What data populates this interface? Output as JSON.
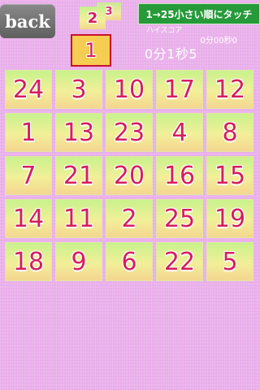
{
  "header": {
    "back_label": "back",
    "instruction": "1→25小さい順にタッチ",
    "highscore_label": "ハイスコア",
    "highscore_value": "0分00秒0",
    "timer": "0分1秒5"
  },
  "next_numbers": {
    "first": "2",
    "second": "3"
  },
  "current_number": "1",
  "grid": {
    "rows": [
      [
        "24",
        "3",
        "10",
        "17",
        "12"
      ],
      [
        "1",
        "13",
        "23",
        "4",
        "8"
      ],
      [
        "7",
        "21",
        "20",
        "16",
        "15"
      ],
      [
        "14",
        "11",
        "2",
        "25",
        "19"
      ],
      [
        "18",
        "9",
        "6",
        "22",
        "5"
      ]
    ]
  },
  "colors": {
    "background": "#ebb2ec",
    "number": "#d41f5c",
    "instruction_bg": "#269a39",
    "current_border": "#c8102e"
  }
}
